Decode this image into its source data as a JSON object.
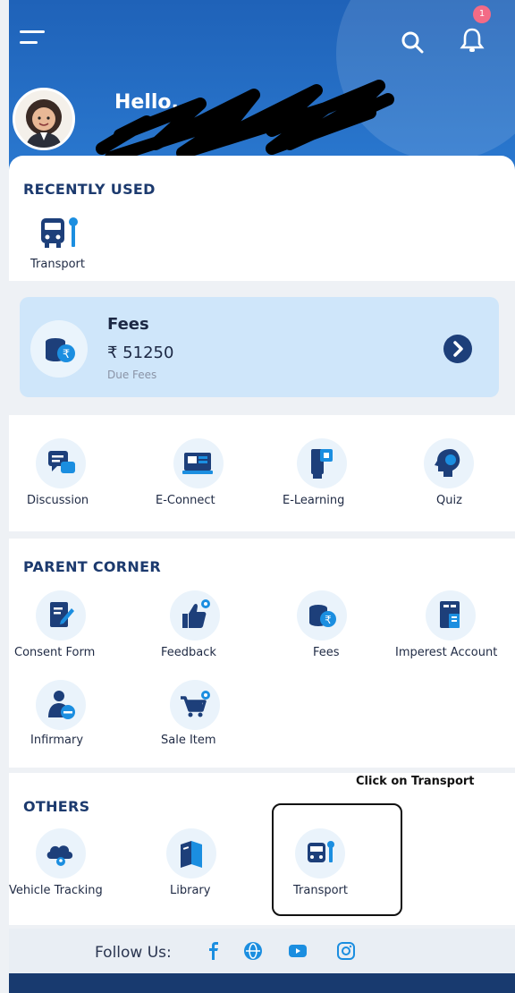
{
  "header": {
    "greeting": "Hello.",
    "notification_count": "1"
  },
  "recently_used": {
    "title": "RECENTLY USED",
    "items": [
      {
        "label": "Transport",
        "icon": "bus-icon"
      }
    ]
  },
  "fees_card": {
    "title": "Fees",
    "amount": "₹ 51250",
    "subtitle": "Due Fees"
  },
  "quick_links": [
    {
      "label": "Discussion",
      "icon": "chat-icon"
    },
    {
      "label": "E-Connect",
      "icon": "connect-icon"
    },
    {
      "label": "E-Learning",
      "icon": "learning-icon"
    },
    {
      "label": "Quiz",
      "icon": "quiz-icon"
    }
  ],
  "parent_corner": {
    "title": "PARENT CORNER",
    "items": [
      {
        "label": "Consent Form",
        "icon": "consent-form-icon"
      },
      {
        "label": "Feedback",
        "icon": "thumbs-up-icon"
      },
      {
        "label": "Fees",
        "icon": "fees-coin-icon"
      },
      {
        "label": "Imperest Account",
        "icon": "ledger-icon"
      },
      {
        "label": "Infirmary",
        "icon": "medical-icon"
      },
      {
        "label": "Sale Item",
        "icon": "cart-icon"
      }
    ]
  },
  "others": {
    "title": "OTHERS",
    "items": [
      {
        "label": "Vehicle Tracking",
        "icon": "cloud-location-icon"
      },
      {
        "label": "Library",
        "icon": "books-icon"
      },
      {
        "label": "Transport",
        "icon": "bus-icon"
      }
    ]
  },
  "annotation": "Click on Transport",
  "footer": {
    "follow_label": "Follow Us:",
    "social": [
      "facebook-icon",
      "website-icon",
      "youtube-icon",
      "instagram-icon"
    ]
  },
  "colors": {
    "header": "#1f62b8",
    "accent": "#1b8ee0",
    "dark": "#1d3f7a"
  }
}
